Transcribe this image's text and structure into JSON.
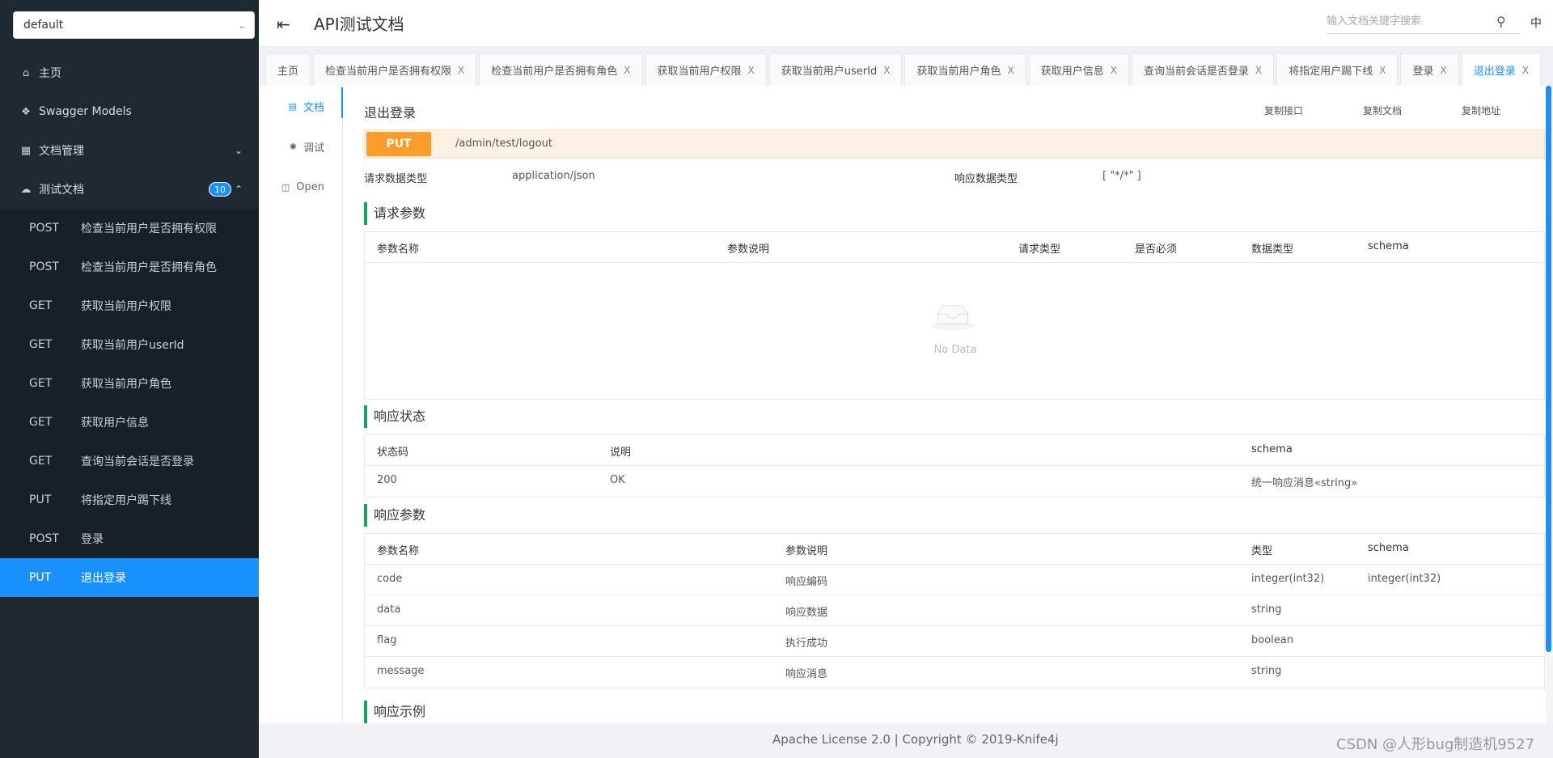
{
  "sidebar": {
    "group_select": "default",
    "nav": [
      {
        "label": "主页"
      },
      {
        "label": "Swagger Models"
      },
      {
        "label": "文档管理"
      },
      {
        "label": "测试文档",
        "count": "10"
      }
    ],
    "operations": [
      {
        "method": "POST",
        "label": "检查当前用户是否拥有权限"
      },
      {
        "method": "POST",
        "label": "检查当前用户是否拥有角色"
      },
      {
        "method": "GET",
        "label": "获取当前用户权限"
      },
      {
        "method": "GET",
        "label": "获取当前用户userId"
      },
      {
        "method": "GET",
        "label": "获取当前用户角色"
      },
      {
        "method": "GET",
        "label": "获取用户信息"
      },
      {
        "method": "GET",
        "label": "查询当前会话是否登录"
      },
      {
        "method": "PUT",
        "label": "将指定用户踢下线"
      },
      {
        "method": "POST",
        "label": "登录"
      },
      {
        "method": "PUT",
        "label": "退出登录"
      }
    ]
  },
  "header": {
    "title": "API测试文档",
    "search_placeholder": "输入文档关键字搜索",
    "lang": "中"
  },
  "tabs": [
    {
      "label": "主页"
    },
    {
      "label": "检查当前用户是否拥有权限"
    },
    {
      "label": "检查当前用户是否拥有角色"
    },
    {
      "label": "获取当前用户权限"
    },
    {
      "label": "获取当前用户userId"
    },
    {
      "label": "获取当前用户角色"
    },
    {
      "label": "获取用户信息"
    },
    {
      "label": "查询当前会话是否登录"
    },
    {
      "label": "将指定用户踢下线"
    },
    {
      "label": "登录"
    },
    {
      "label": "退出登录"
    }
  ],
  "tab_close": "X",
  "vtabs": [
    {
      "label": "文档"
    },
    {
      "label": "调试"
    },
    {
      "label": "Open"
    }
  ],
  "doc": {
    "title": "退出登录",
    "copy_links": [
      "复制接口",
      "复制文档",
      "复制地址"
    ],
    "method": "PUT",
    "path": "/admin/test/logout",
    "request_type_label": "请求数据类型",
    "request_type": "application/json",
    "response_type_label": "响应数据类型",
    "response_type": "[ \"*/*\" ]",
    "req_params": {
      "title": "请求参数",
      "headers": [
        "参数名称",
        "参数说明",
        "请求类型",
        "是否必须",
        "数据类型",
        "schema"
      ],
      "empty": "No Data"
    },
    "resp_status": {
      "title": "响应状态",
      "headers": [
        "状态码",
        "说明",
        "schema"
      ],
      "rows": [
        [
          "200",
          "OK",
          "统一响应消息«string»"
        ]
      ]
    },
    "resp_params": {
      "title": "响应参数",
      "headers": [
        "参数名称",
        "参数说明",
        "类型",
        "schema"
      ],
      "rows": [
        [
          "code",
          "响应编码",
          "integer(int32)",
          "integer(int32)"
        ],
        [
          "data",
          "响应数据",
          "string",
          ""
        ],
        [
          "flag",
          "执行成功",
          "boolean",
          ""
        ],
        [
          "message",
          "响应消息",
          "string",
          ""
        ]
      ]
    },
    "resp_example_title": "响应示例"
  },
  "footer": {
    "license": "Apache License 2.0 | Copyright © 2019-Knife4j"
  },
  "watermark": "CSDN @人形bug制造机9527"
}
